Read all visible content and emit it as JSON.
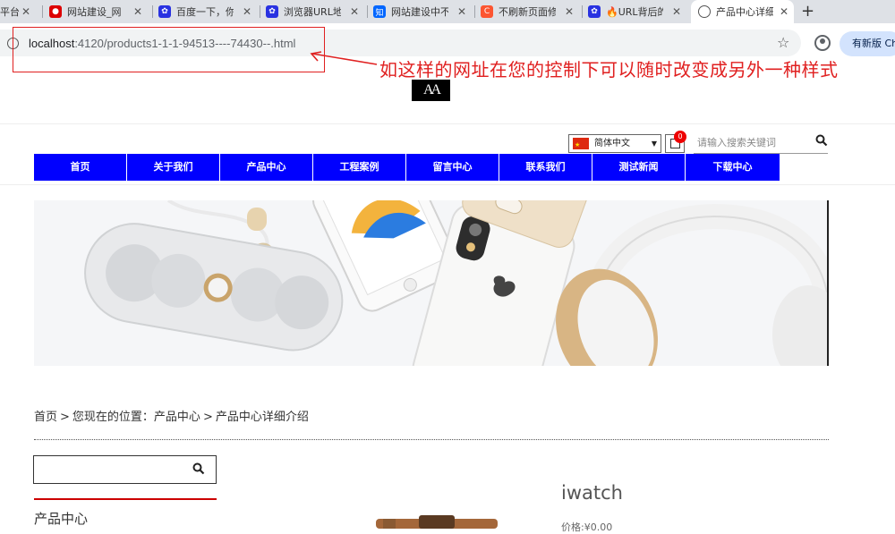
{
  "browser": {
    "tabs": [
      {
        "title": "平台",
        "icon": "tab-favicon"
      },
      {
        "title": "网站建设_网",
        "icon": "weibo-icon"
      },
      {
        "title": "百度一下，你",
        "icon": "baidu-icon"
      },
      {
        "title": "浏览器URL地",
        "icon": "baidu-icon"
      },
      {
        "title": "网站建设中不",
        "icon": "zhihu-icon"
      },
      {
        "title": "不刷新页面修",
        "icon": "csdn-icon"
      },
      {
        "title": "🔥URL背后的",
        "icon": "baidu-icon"
      },
      {
        "title": "产品中心详细",
        "icon": "globe-icon",
        "active": true
      }
    ],
    "url_host": "localhost",
    "url_path": ":4120/products1-1-1-94513----74430--.html",
    "update_button": "有新版 Ch"
  },
  "annotation": {
    "text": "如这样的网址在您的控制下可以随时改变成另外一种样式",
    "color": "#e02020"
  },
  "site": {
    "logo_text": "AA",
    "language": "简体中文",
    "cart_count": "0",
    "search_placeholder": "请输入搜索关键词",
    "nav": [
      "首页",
      "关于我们",
      "产品中心",
      "工程案例",
      "留言中心",
      "联系我们",
      "测试新闻",
      "下载中心"
    ],
    "nav_color": "#0000ff",
    "breadcrumb": [
      "首页",
      ">",
      "您现在的位置：产品中心",
      ">",
      "产品中心详细介绍"
    ],
    "sidebar_title": "产品中心",
    "product_name": "iwatch",
    "price": "价格:¥0.00"
  }
}
